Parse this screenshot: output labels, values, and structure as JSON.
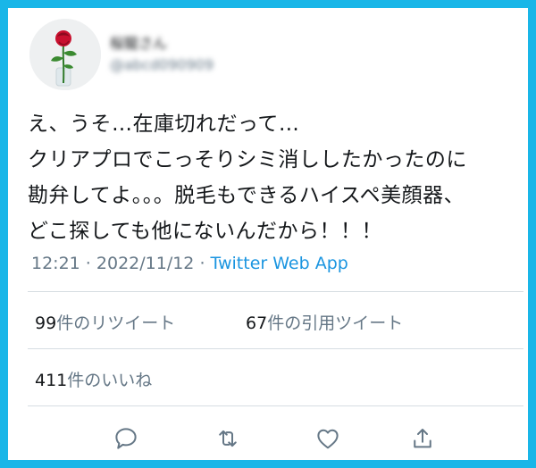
{
  "author": {
    "display_name": "桜龍さん",
    "handle": "@abcd090909"
  },
  "tweet": {
    "lines": [
      "え、うそ…在庫切れだって…",
      "クリアプロでこっそりシミ消ししたかったのに",
      "勘弁してよ。。。脱毛もできるハイスペ美顔器、",
      "どこ探しても他にないんだから！！！"
    ],
    "time": "12:21",
    "date": "2022/11/12",
    "separator": " · ",
    "source": "Twitter Web App"
  },
  "stats": {
    "retweets_count": "99",
    "retweets_label": "件のリツイート",
    "quotes_count": "67",
    "quotes_label": "件の引用ツイート",
    "likes_count": "411",
    "likes_label": "件のいいね"
  },
  "colors": {
    "frame": "#19b6e8",
    "link": "#1b95e0",
    "muted": "#657786",
    "text": "#14171a"
  },
  "icons": [
    "reply-icon",
    "retweet-icon",
    "like-icon",
    "share-icon"
  ]
}
